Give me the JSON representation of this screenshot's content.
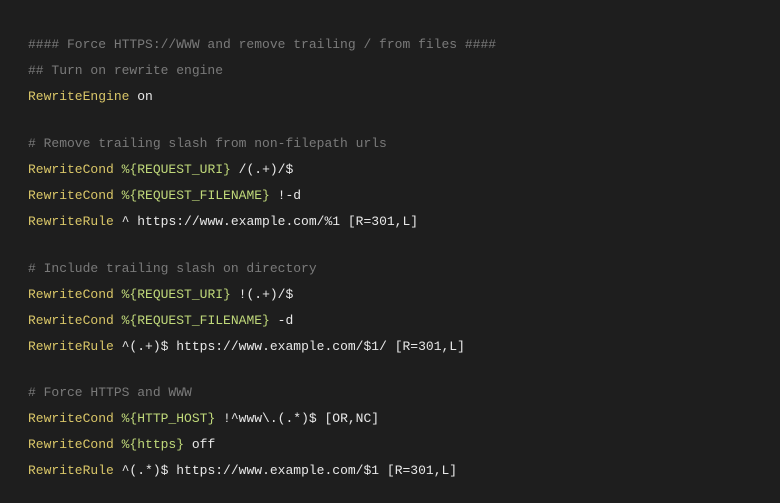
{
  "lines": {
    "l1": {
      "comment": "#### Force HTTPS://WWW and remove trailing / from files ####"
    },
    "l2": {
      "comment": "## Turn on rewrite engine"
    },
    "l3": {
      "directive": "RewriteEngine",
      "arg": " on"
    },
    "l4": {
      "comment": "# Remove trailing slash from non-filepath urls"
    },
    "l5": {
      "directive": "RewriteCond",
      "var": " %{REQUEST_URI}",
      "arg": " /(.+)/$"
    },
    "l6": {
      "directive": "RewriteCond",
      "var": " %{REQUEST_FILENAME}",
      "arg": " !-d"
    },
    "l7": {
      "directive": "RewriteRule",
      "arg1": " ^ ",
      "url": "https://www.example.com/%1",
      "flags": " [R=301,L]"
    },
    "l8": {
      "comment": "# Include trailing slash on directory"
    },
    "l9": {
      "directive": "RewriteCond",
      "var": " %{REQUEST_URI}",
      "arg": " !(.+)/$"
    },
    "l10": {
      "directive": "RewriteCond",
      "var": " %{REQUEST_FILENAME}",
      "arg": " -d"
    },
    "l11": {
      "directive": "RewriteRule",
      "arg1": " ^(.+)$ ",
      "url": "https://www.example.com/$1/",
      "flags": " [R=301,L]"
    },
    "l12": {
      "comment": "# Force HTTPS and WWW"
    },
    "l13": {
      "directive": "RewriteCond",
      "var": " %{HTTP_HOST}",
      "arg": " !^www\\.(.*)$",
      "flags": " [OR,NC]"
    },
    "l14": {
      "directive": "RewriteCond",
      "var": " %{https}",
      "arg": " off"
    },
    "l15": {
      "directive": "RewriteRule",
      "arg1": " ^(.*)$ ",
      "url": "https://www.example.com/$1",
      "flags": " [R=301,L]"
    }
  }
}
